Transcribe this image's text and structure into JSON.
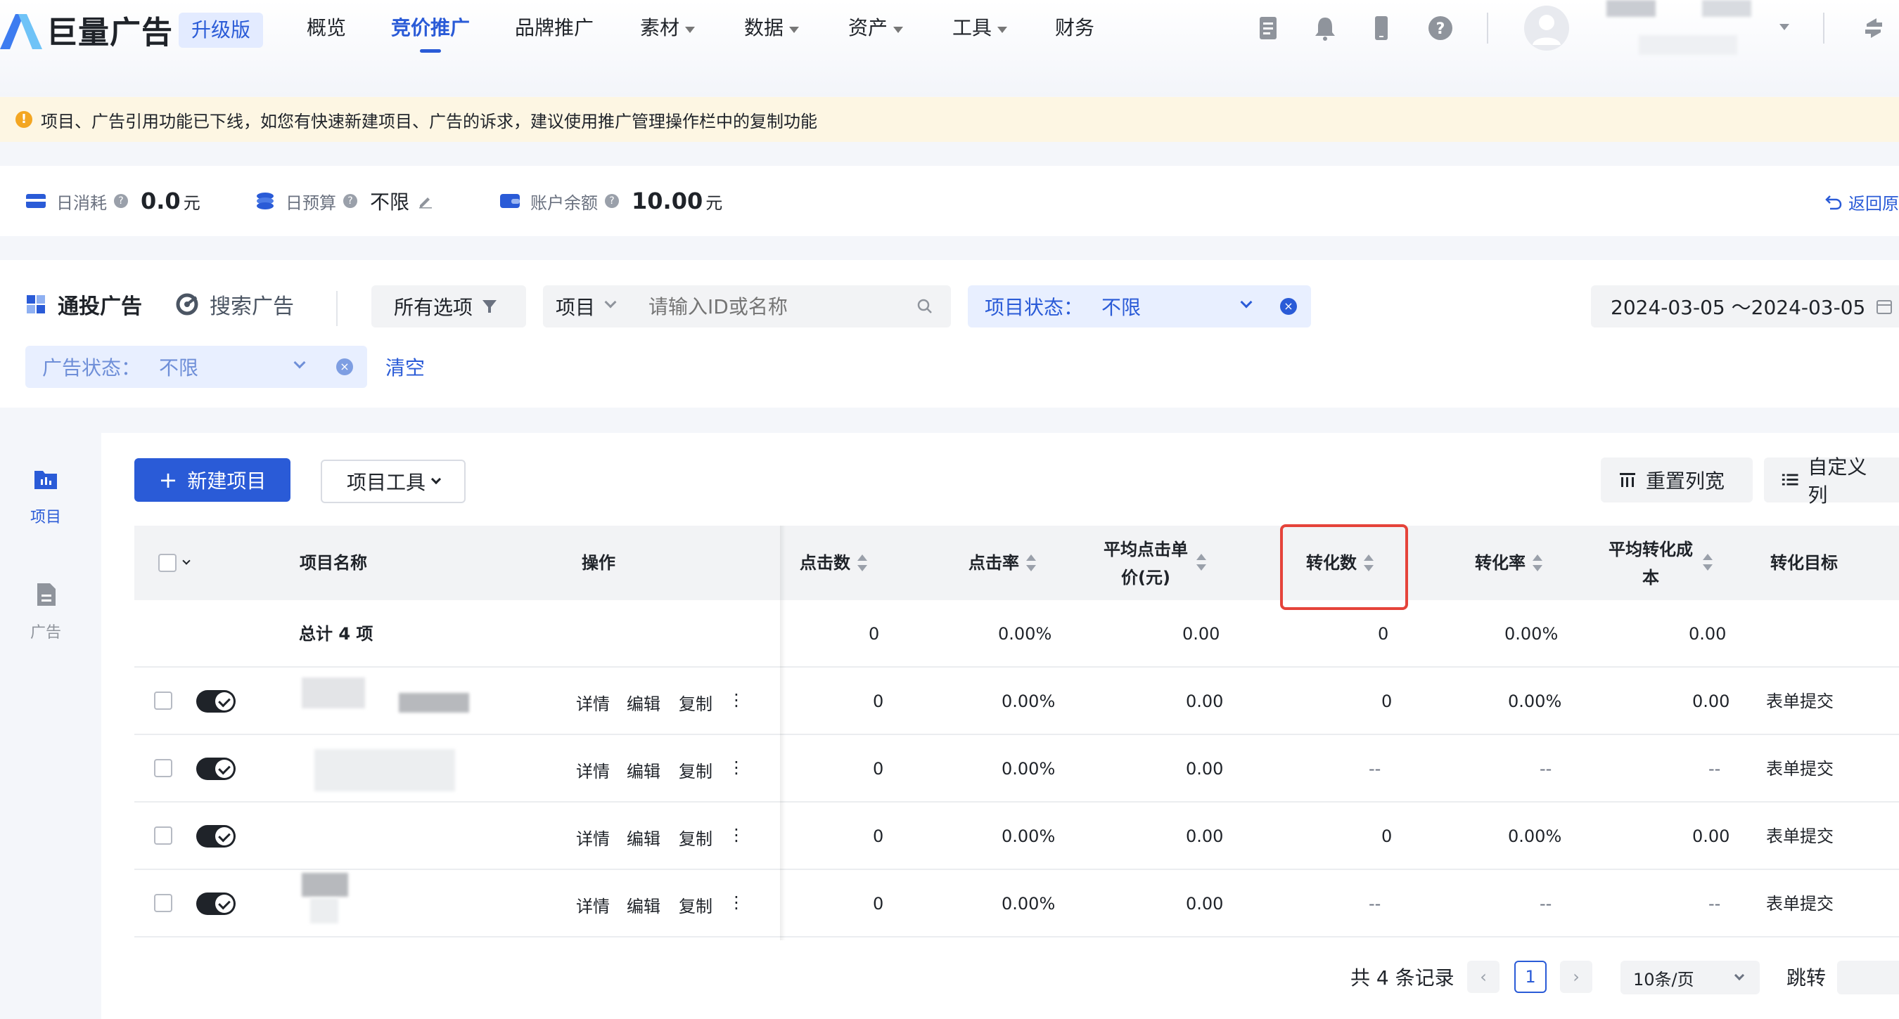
{
  "nav": {
    "logo_text": "巨量广告",
    "badge": "升级版",
    "items": [
      {
        "label": "概览"
      },
      {
        "label": "竞价推广",
        "active": true
      },
      {
        "label": "品牌推广"
      },
      {
        "label": "素材"
      },
      {
        "label": "数据"
      },
      {
        "label": "资产"
      },
      {
        "label": "工具"
      },
      {
        "label": "财务"
      }
    ],
    "icons": [
      "document-icon",
      "bell-icon",
      "phone-icon",
      "help-icon"
    ]
  },
  "notice": {
    "icon": "!",
    "text": "项目、广告引用功能已下线，如您有快速新建项目、广告的诉求，建议使用推广管理操作栏中的复制功能"
  },
  "stats": {
    "daily_spend": {
      "label": "日消耗",
      "value": "0.0",
      "unit": "元"
    },
    "daily_budget": {
      "label": "日预算",
      "value": "不限"
    },
    "balance": {
      "label": "账户余额",
      "value": "10.00",
      "unit": "元"
    },
    "back_label": "返回原"
  },
  "filters": {
    "tab_active": "通投广告",
    "tab_inactive": "搜索广告",
    "all_options": "所有选项",
    "search_type": "项目",
    "search_placeholder": "请输入ID或名称",
    "project_status_label": "项目状态：",
    "project_status_value": "不限",
    "date_range": "2024-03-05 ～2024-03-05",
    "ad_status_label": "广告状态：",
    "ad_status_value": "不限",
    "clear": "清空"
  },
  "rail": {
    "project": "项目",
    "ad": "广告"
  },
  "toolbar": {
    "new_project": "新建项目",
    "project_tools": "项目工具",
    "reset_width": "重置列宽",
    "custom_columns": "自定义列"
  },
  "table": {
    "headers": {
      "name": "项目名称",
      "ops": "操作",
      "clicks": "点击数",
      "ctr": "点击率",
      "cpc_line1": "平均点击单",
      "cpc_line2": "价(元)",
      "conversions": "转化数",
      "cvr": "转化率",
      "cpa_line1": "平均转化成",
      "cpa_line2": "本",
      "goal": "转化目标"
    },
    "summary": {
      "label": "总计 4 项",
      "clicks": "0",
      "ctr": "0.00%",
      "cpc": "0.00",
      "conversions": "0",
      "cvr": "0.00%",
      "cpa": "0.00"
    },
    "op_labels": {
      "detail": "详情",
      "edit": "编辑",
      "copy": "复制",
      "more": "⋮"
    },
    "rows": [
      {
        "clicks": "0",
        "ctr": "0.00%",
        "cpc": "0.00",
        "conversions": "0",
        "cvr": "0.00%",
        "cpa": "0.00",
        "goal": "表单提交"
      },
      {
        "clicks": "0",
        "ctr": "0.00%",
        "cpc": "0.00",
        "conversions": "--",
        "cvr": "--",
        "cpa": "--",
        "goal": "表单提交"
      },
      {
        "clicks": "0",
        "ctr": "0.00%",
        "cpc": "0.00",
        "conversions": "0",
        "cvr": "0.00%",
        "cpa": "0.00",
        "goal": "表单提交"
      },
      {
        "clicks": "0",
        "ctr": "0.00%",
        "cpc": "0.00",
        "conversions": "--",
        "cvr": "--",
        "cpa": "--",
        "goal": "表单提交"
      }
    ]
  },
  "pagination": {
    "total": "共 4 条记录",
    "current_page": "1",
    "page_size": "10条/页",
    "jump": "跳转"
  },
  "colors": {
    "primary": "#2a5bd7",
    "highlight": "#e5433a",
    "notice_bg": "#fdf6e3"
  }
}
